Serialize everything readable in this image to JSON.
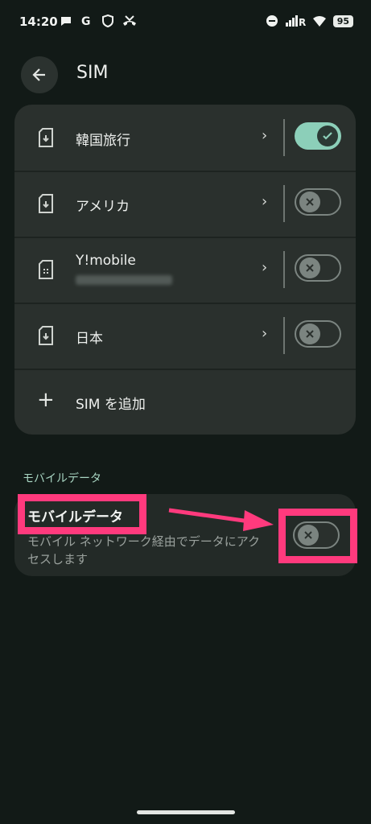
{
  "status": {
    "time": "14:20",
    "battery": "95",
    "left_icons": [
      "chat-bubble-icon",
      "google-g-icon",
      "shield-icon",
      "missed-call-icon"
    ],
    "right_icons": [
      "do-not-disturb-icon",
      "signal-icon",
      "wifi-icon",
      "battery-icon"
    ],
    "signal_label": "R"
  },
  "header": {
    "title": "SIM"
  },
  "sims": [
    {
      "label": "韓国旅行",
      "enabled": true
    },
    {
      "label": "アメリカ",
      "enabled": false
    },
    {
      "label": "Y!mobile",
      "enabled": false
    },
    {
      "label": "日本",
      "enabled": false
    }
  ],
  "add_sim_label": "SIM を追加",
  "mobile_data": {
    "section_header": "モバイルデータ",
    "title": "モバイルデータ",
    "subtitle": "モバイル ネットワーク経由でデータにアクセスします",
    "enabled": false
  },
  "colors": {
    "accent": "#8ccfb9",
    "highlight": "#ff3a7d",
    "background": "#121a17"
  }
}
